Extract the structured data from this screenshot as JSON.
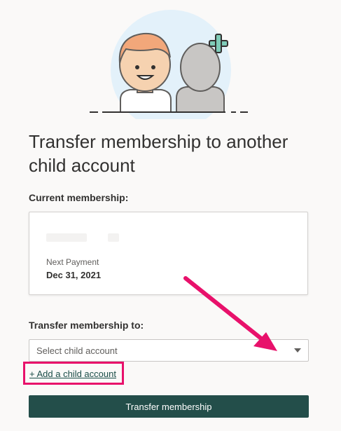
{
  "page": {
    "title": "Transfer membership to another child account"
  },
  "current": {
    "label": "Current membership:",
    "next_payment_label": "Next Payment",
    "next_payment_date": "Dec 31, 2021"
  },
  "transfer": {
    "label": "Transfer membership to:",
    "select_placeholder": "Select child account",
    "add_link": "+ Add a child account",
    "button": "Transfer membership"
  },
  "colors": {
    "primary_button": "#234e4a",
    "highlight": "#e8116b",
    "plus_accent": "#7ecbb8"
  }
}
